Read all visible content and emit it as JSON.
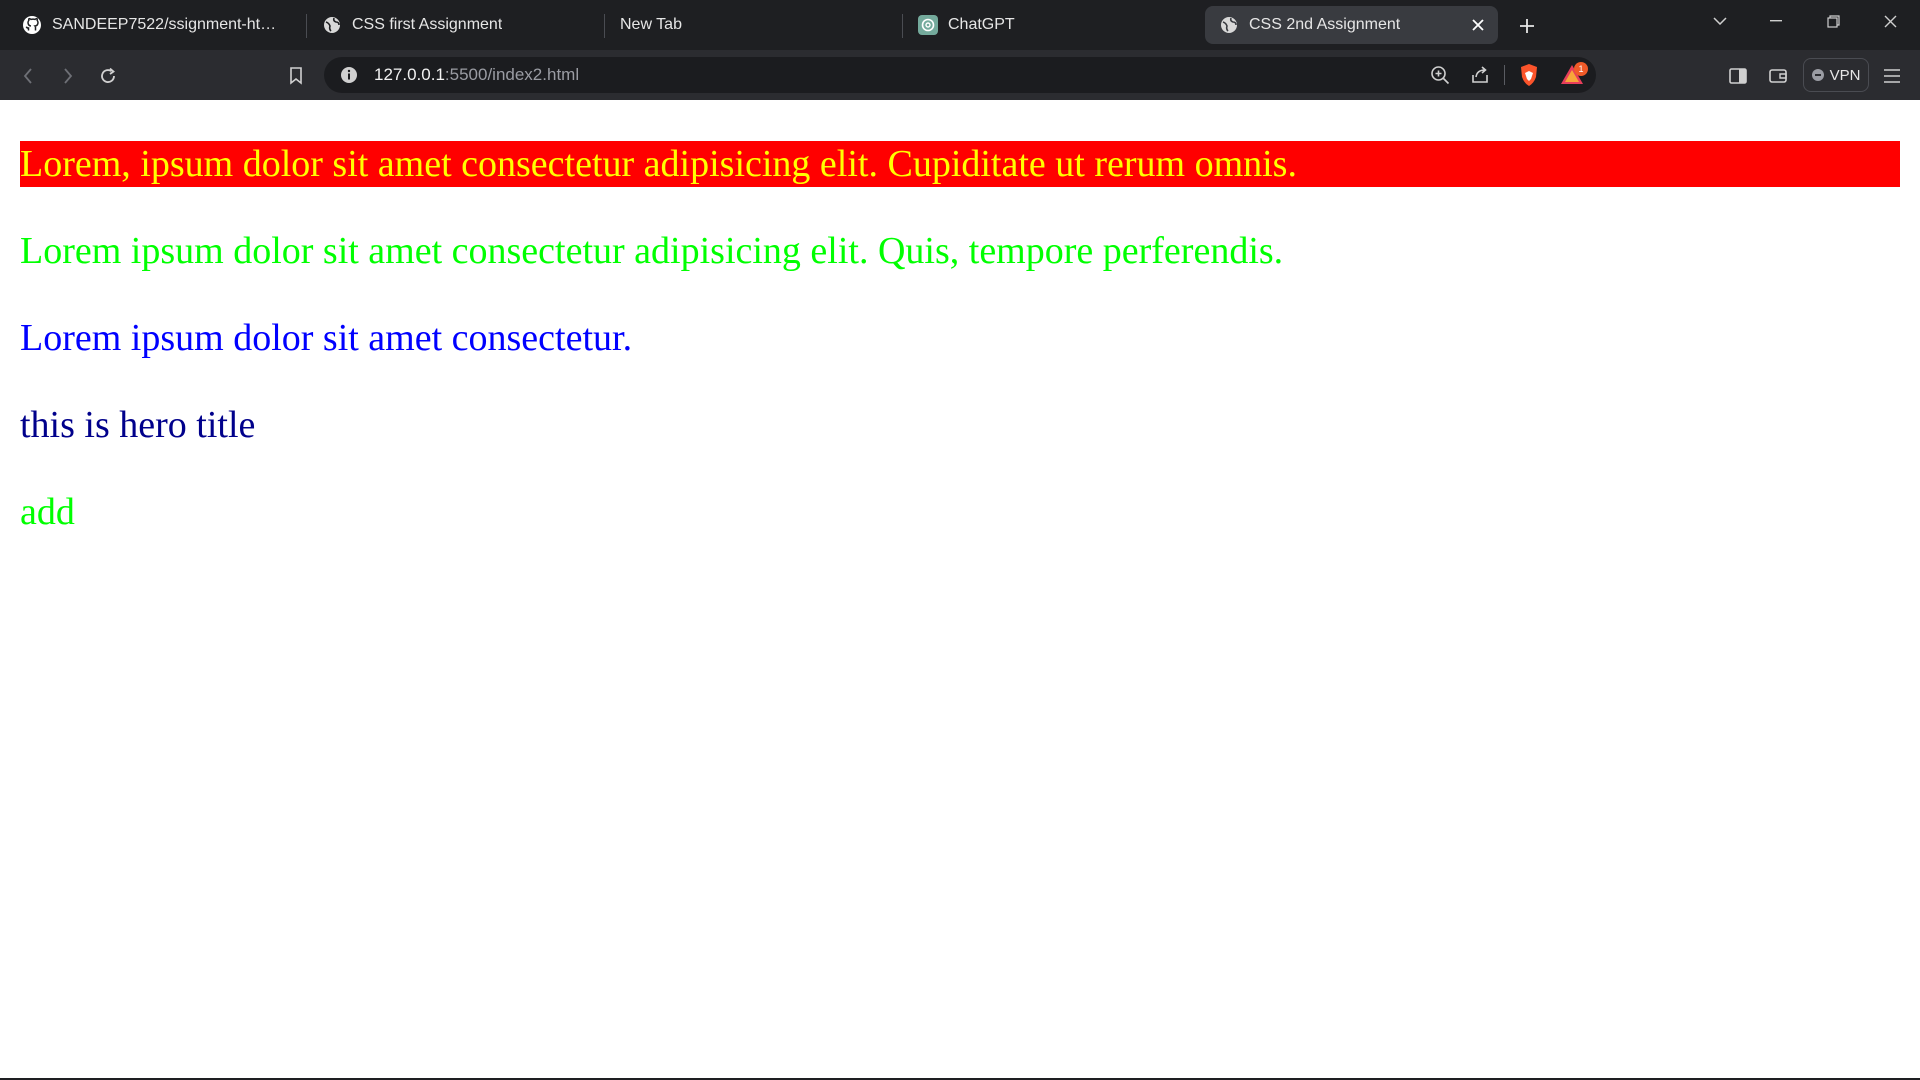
{
  "tabs": [
    {
      "label": "SANDEEP7522/ssignment-html-2",
      "icon": "github-icon"
    },
    {
      "label": "CSS first Assignment",
      "icon": "globe-icon"
    },
    {
      "label": "New Tab",
      "icon": ""
    },
    {
      "label": "ChatGPT",
      "icon": "chatgpt-icon"
    },
    {
      "label": "CSS 2nd Assignment",
      "icon": "globe-icon",
      "active": true
    }
  ],
  "address_bar": {
    "host": "127.0.0.1",
    "rest": ":5500/index2.html"
  },
  "toolbar": {
    "vpn_label": "VPN",
    "rewards_badge": "1"
  },
  "content": {
    "paragraphs": [
      "Lorem, ipsum dolor sit amet consectetur adipisicing elit. Cupiditate ut rerum omnis.",
      "Lorem ipsum dolor sit amet consectetur adipisicing elit. Quis, tempore perferendis.",
      "Lorem ipsum dolor sit amet consectetur.",
      "this is hero title",
      "add"
    ]
  },
  "colors": {
    "highlight_bg": "#ff0000",
    "highlight_text": "#ffff00",
    "green_text": "#00ff00",
    "blue_text": "#0000ff",
    "navy_text": "#00008b",
    "chrome_dark": "#1e1f22"
  }
}
